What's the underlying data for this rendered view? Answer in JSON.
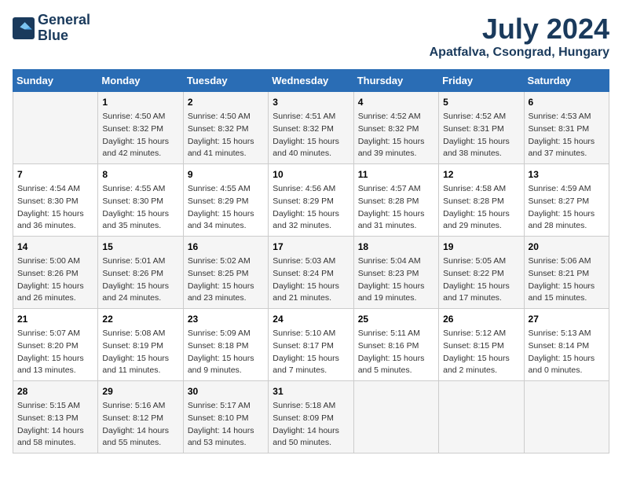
{
  "logo": {
    "line1": "General",
    "line2": "Blue"
  },
  "title": "July 2024",
  "location": "Apatfalva, Csongrad, Hungary",
  "headers": [
    "Sunday",
    "Monday",
    "Tuesday",
    "Wednesday",
    "Thursday",
    "Friday",
    "Saturday"
  ],
  "weeks": [
    [
      {
        "day": "",
        "sunrise": "",
        "sunset": "",
        "daylight": ""
      },
      {
        "day": "1",
        "sunrise": "Sunrise: 4:50 AM",
        "sunset": "Sunset: 8:32 PM",
        "daylight": "Daylight: 15 hours and 42 minutes."
      },
      {
        "day": "2",
        "sunrise": "Sunrise: 4:50 AM",
        "sunset": "Sunset: 8:32 PM",
        "daylight": "Daylight: 15 hours and 41 minutes."
      },
      {
        "day": "3",
        "sunrise": "Sunrise: 4:51 AM",
        "sunset": "Sunset: 8:32 PM",
        "daylight": "Daylight: 15 hours and 40 minutes."
      },
      {
        "day": "4",
        "sunrise": "Sunrise: 4:52 AM",
        "sunset": "Sunset: 8:32 PM",
        "daylight": "Daylight: 15 hours and 39 minutes."
      },
      {
        "day": "5",
        "sunrise": "Sunrise: 4:52 AM",
        "sunset": "Sunset: 8:31 PM",
        "daylight": "Daylight: 15 hours and 38 minutes."
      },
      {
        "day": "6",
        "sunrise": "Sunrise: 4:53 AM",
        "sunset": "Sunset: 8:31 PM",
        "daylight": "Daylight: 15 hours and 37 minutes."
      }
    ],
    [
      {
        "day": "7",
        "sunrise": "Sunrise: 4:54 AM",
        "sunset": "Sunset: 8:30 PM",
        "daylight": "Daylight: 15 hours and 36 minutes."
      },
      {
        "day": "8",
        "sunrise": "Sunrise: 4:55 AM",
        "sunset": "Sunset: 8:30 PM",
        "daylight": "Daylight: 15 hours and 35 minutes."
      },
      {
        "day": "9",
        "sunrise": "Sunrise: 4:55 AM",
        "sunset": "Sunset: 8:29 PM",
        "daylight": "Daylight: 15 hours and 34 minutes."
      },
      {
        "day": "10",
        "sunrise": "Sunrise: 4:56 AM",
        "sunset": "Sunset: 8:29 PM",
        "daylight": "Daylight: 15 hours and 32 minutes."
      },
      {
        "day": "11",
        "sunrise": "Sunrise: 4:57 AM",
        "sunset": "Sunset: 8:28 PM",
        "daylight": "Daylight: 15 hours and 31 minutes."
      },
      {
        "day": "12",
        "sunrise": "Sunrise: 4:58 AM",
        "sunset": "Sunset: 8:28 PM",
        "daylight": "Daylight: 15 hours and 29 minutes."
      },
      {
        "day": "13",
        "sunrise": "Sunrise: 4:59 AM",
        "sunset": "Sunset: 8:27 PM",
        "daylight": "Daylight: 15 hours and 28 minutes."
      }
    ],
    [
      {
        "day": "14",
        "sunrise": "Sunrise: 5:00 AM",
        "sunset": "Sunset: 8:26 PM",
        "daylight": "Daylight: 15 hours and 26 minutes."
      },
      {
        "day": "15",
        "sunrise": "Sunrise: 5:01 AM",
        "sunset": "Sunset: 8:26 PM",
        "daylight": "Daylight: 15 hours and 24 minutes."
      },
      {
        "day": "16",
        "sunrise": "Sunrise: 5:02 AM",
        "sunset": "Sunset: 8:25 PM",
        "daylight": "Daylight: 15 hours and 23 minutes."
      },
      {
        "day": "17",
        "sunrise": "Sunrise: 5:03 AM",
        "sunset": "Sunset: 8:24 PM",
        "daylight": "Daylight: 15 hours and 21 minutes."
      },
      {
        "day": "18",
        "sunrise": "Sunrise: 5:04 AM",
        "sunset": "Sunset: 8:23 PM",
        "daylight": "Daylight: 15 hours and 19 minutes."
      },
      {
        "day": "19",
        "sunrise": "Sunrise: 5:05 AM",
        "sunset": "Sunset: 8:22 PM",
        "daylight": "Daylight: 15 hours and 17 minutes."
      },
      {
        "day": "20",
        "sunrise": "Sunrise: 5:06 AM",
        "sunset": "Sunset: 8:21 PM",
        "daylight": "Daylight: 15 hours and 15 minutes."
      }
    ],
    [
      {
        "day": "21",
        "sunrise": "Sunrise: 5:07 AM",
        "sunset": "Sunset: 8:20 PM",
        "daylight": "Daylight: 15 hours and 13 minutes."
      },
      {
        "day": "22",
        "sunrise": "Sunrise: 5:08 AM",
        "sunset": "Sunset: 8:19 PM",
        "daylight": "Daylight: 15 hours and 11 minutes."
      },
      {
        "day": "23",
        "sunrise": "Sunrise: 5:09 AM",
        "sunset": "Sunset: 8:18 PM",
        "daylight": "Daylight: 15 hours and 9 minutes."
      },
      {
        "day": "24",
        "sunrise": "Sunrise: 5:10 AM",
        "sunset": "Sunset: 8:17 PM",
        "daylight": "Daylight: 15 hours and 7 minutes."
      },
      {
        "day": "25",
        "sunrise": "Sunrise: 5:11 AM",
        "sunset": "Sunset: 8:16 PM",
        "daylight": "Daylight: 15 hours and 5 minutes."
      },
      {
        "day": "26",
        "sunrise": "Sunrise: 5:12 AM",
        "sunset": "Sunset: 8:15 PM",
        "daylight": "Daylight: 15 hours and 2 minutes."
      },
      {
        "day": "27",
        "sunrise": "Sunrise: 5:13 AM",
        "sunset": "Sunset: 8:14 PM",
        "daylight": "Daylight: 15 hours and 0 minutes."
      }
    ],
    [
      {
        "day": "28",
        "sunrise": "Sunrise: 5:15 AM",
        "sunset": "Sunset: 8:13 PM",
        "daylight": "Daylight: 14 hours and 58 minutes."
      },
      {
        "day": "29",
        "sunrise": "Sunrise: 5:16 AM",
        "sunset": "Sunset: 8:12 PM",
        "daylight": "Daylight: 14 hours and 55 minutes."
      },
      {
        "day": "30",
        "sunrise": "Sunrise: 5:17 AM",
        "sunset": "Sunset: 8:10 PM",
        "daylight": "Daylight: 14 hours and 53 minutes."
      },
      {
        "day": "31",
        "sunrise": "Sunrise: 5:18 AM",
        "sunset": "Sunset: 8:09 PM",
        "daylight": "Daylight: 14 hours and 50 minutes."
      },
      {
        "day": "",
        "sunrise": "",
        "sunset": "",
        "daylight": ""
      },
      {
        "day": "",
        "sunrise": "",
        "sunset": "",
        "daylight": ""
      },
      {
        "day": "",
        "sunrise": "",
        "sunset": "",
        "daylight": ""
      }
    ]
  ]
}
